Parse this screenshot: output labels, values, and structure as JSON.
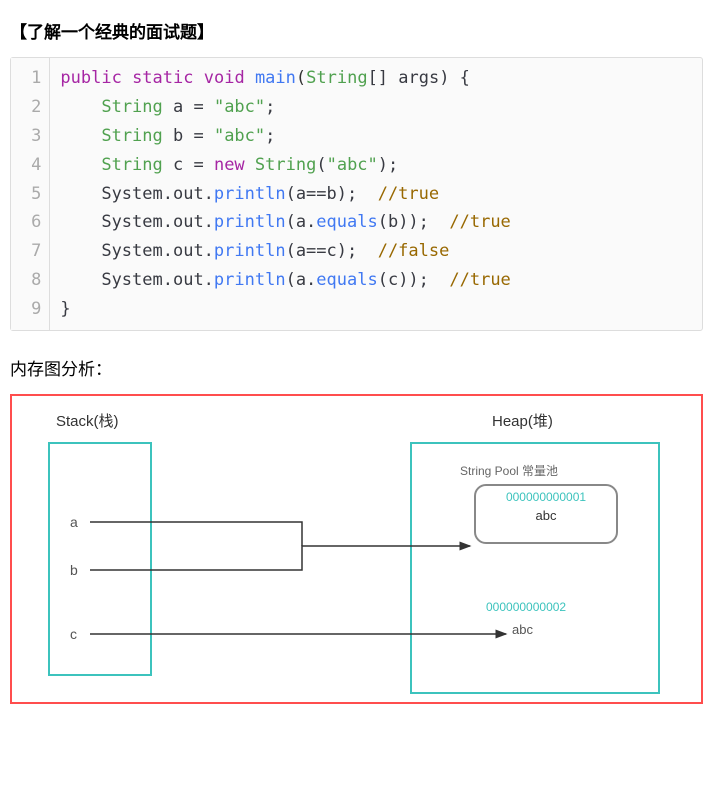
{
  "title": "【了解一个经典的面试题】",
  "code": {
    "lines": [
      "1",
      "2",
      "3",
      "4",
      "5",
      "6",
      "7",
      "8",
      "9"
    ],
    "l1_kw1": "public",
    "l1_kw2": "static",
    "l1_kw3": "void",
    "l1_fn": "main",
    "l1_type": "String",
    "l1_rest": "[] args) {",
    "l2_type": "String",
    "l2_rest": " a = ",
    "l2_str": "\"abc\"",
    "l2_semi": ";",
    "l3_type": "String",
    "l3_rest": " b = ",
    "l3_str": "\"abc\"",
    "l3_semi": ";",
    "l4_type": "String",
    "l4_rest": " c = ",
    "l4_kw": "new",
    "l4_type2": "String",
    "l4_open": "(",
    "l4_str": "\"abc\"",
    "l4_close": ");",
    "l5_pre": "    System.out.",
    "l5_fn": "println",
    "l5_args": "(a==b);  ",
    "l5_cm": "//true",
    "l6_pre": "    System.out.",
    "l6_fn": "println",
    "l6_args": "(a.",
    "l6_fn2": "equals",
    "l6_args2": "(b));  ",
    "l6_cm": "//true",
    "l7_pre": "    System.out.",
    "l7_fn": "println",
    "l7_args": "(a==c);  ",
    "l7_cm": "//false",
    "l8_pre": "    System.out.",
    "l8_fn": "println",
    "l8_args": "(a.",
    "l8_fn2": "equals",
    "l8_args2": "(c));  ",
    "l8_cm": "//true",
    "l9": "}"
  },
  "section_label": "内存图分析：",
  "diagram": {
    "stack_title": "Stack(栈)",
    "heap_title": "Heap(堆)",
    "var_a": "a",
    "var_b": "b",
    "var_c": "c",
    "pool_label": "String Pool 常量池",
    "pool_addr": "000000000001",
    "pool_val": "abc",
    "heap_addr2": "000000000002",
    "heap_val2": "abc"
  }
}
